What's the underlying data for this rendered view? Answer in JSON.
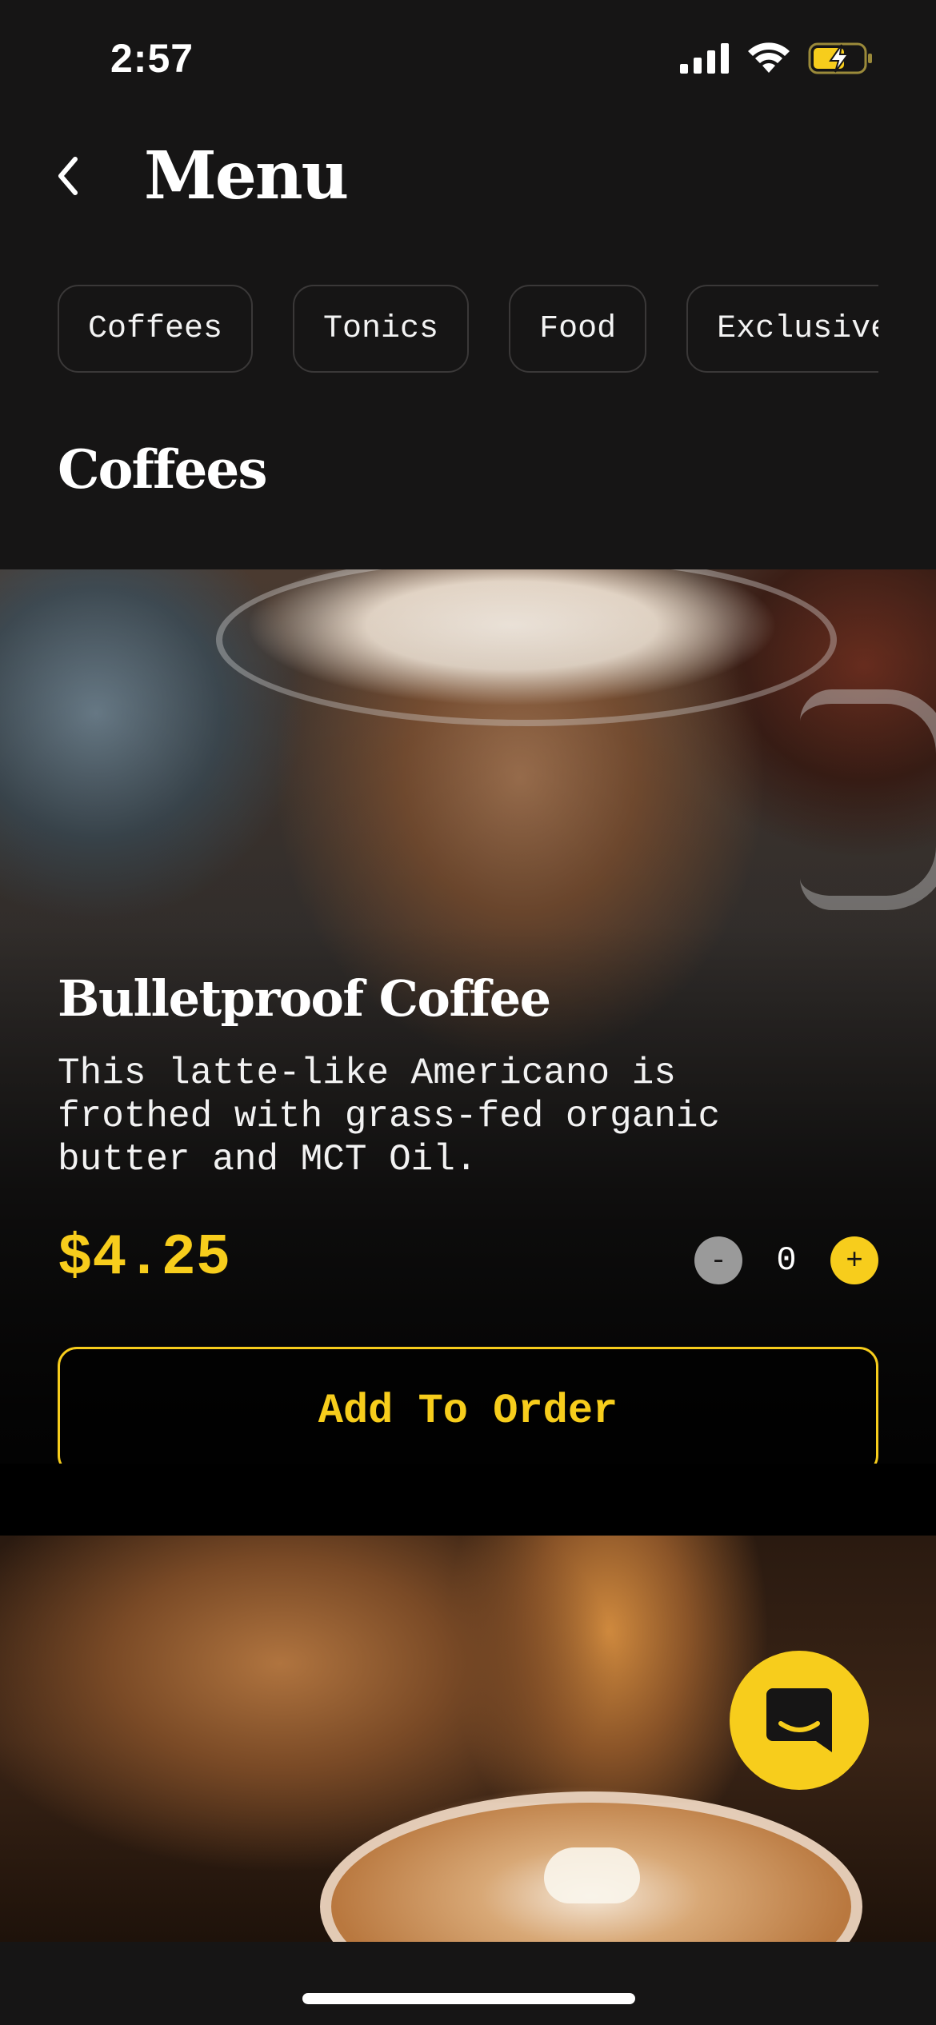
{
  "status_bar": {
    "time": "2:57",
    "icons": [
      "cellular-signal-icon",
      "wifi-icon",
      "battery-charging-icon"
    ]
  },
  "header": {
    "back_icon": "chevron-left-icon",
    "title": "Menu"
  },
  "categories": [
    {
      "label": "Coffees"
    },
    {
      "label": "Tonics"
    },
    {
      "label": "Food"
    },
    {
      "label": "Exclusives"
    }
  ],
  "section": {
    "title": "Coffees"
  },
  "products": [
    {
      "name": "Bulletproof Coffee",
      "description": "This latte-like Americano is frothed with grass-fed organic butter and MCT Oil.",
      "price": "$4.25",
      "quantity": "0",
      "minus_label": "-",
      "plus_label": "+",
      "cta": "Add To Order"
    }
  ],
  "chat_fab": {
    "icon": "chat-icon"
  },
  "colors": {
    "accent": "#f7cd1c",
    "background": "#161515",
    "text": "#ffffff"
  }
}
